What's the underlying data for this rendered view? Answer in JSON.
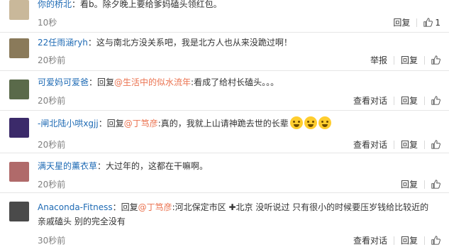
{
  "comments": [
    {
      "username": "你的桥北",
      "text_before": "：看b。除夕晚上要给爹妈磕头领红包。",
      "time": "10秒",
      "actions": [
        "回复"
      ],
      "likes": "1",
      "avatar_color": "#c9b89a"
    },
    {
      "username": "22任雨涵ryh",
      "text_before": "：这与南北方没关系吧，我是北方人也从来没跪过啊！",
      "time": "20秒前",
      "actions": [
        "举报",
        "回复"
      ],
      "avatar_color": "#8a7a5a"
    },
    {
      "username": "可爱妈可爱爸",
      "text_before": "：回复",
      "mention": "@生活中的似水流年",
      "text_after": ":看成了给村长磕头。。。",
      "time": "20秒前",
      "actions": [
        "查看对话",
        "回复"
      ],
      "avatar_color": "#5a6a4a"
    },
    {
      "username": "-闸北陆小哄xgjj",
      "text_before": "：回复",
      "mention": "@丁笃彦",
      "text_after": ":真的，我就上山请神跪去世的长辈",
      "time": "20秒前",
      "actions": [
        "查看对话",
        "回复"
      ],
      "avatar_color": "#3b2a6a"
    },
    {
      "username": "满天星的薰衣草",
      "text_before": "：大过年的，这都在干嘛啊。",
      "time": "20秒前",
      "actions": [
        "回复"
      ],
      "avatar_color": "#b06a6a"
    },
    {
      "username": "Anaconda-Fitness",
      "text_before": "：回复",
      "mention": "@丁笃彦",
      "text_after": ":河北保定市区",
      "text_extra": "北京 没听说过 只有很小的时候要压岁钱给比较近的亲戚磕头 别的完全没有",
      "time": "30秒前",
      "actions": [
        "查看对话",
        "回复"
      ],
      "avatar_color": "#4a4a4a"
    }
  ],
  "colors": {
    "username": "#eb7350",
    "mention": "#eb7350",
    "time": "#808080",
    "border": "#e6e6e6"
  }
}
